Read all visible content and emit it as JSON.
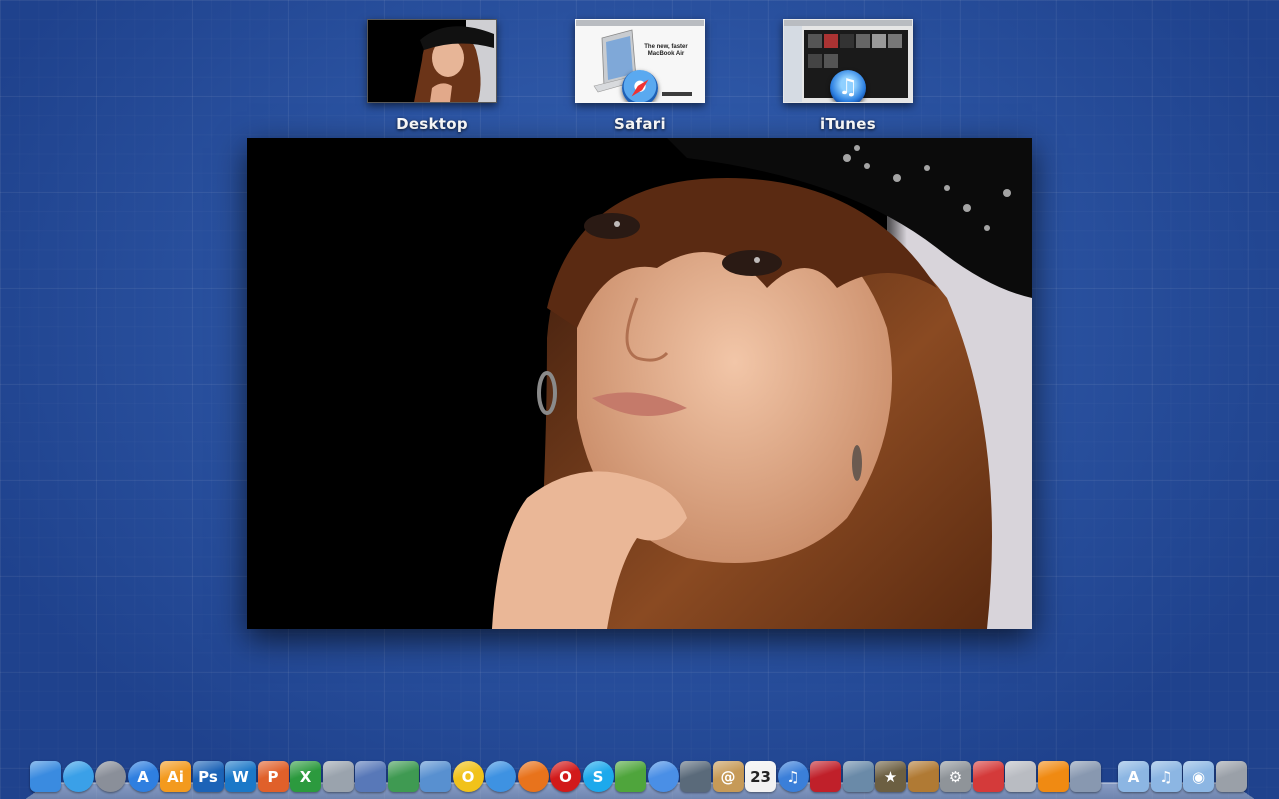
{
  "spaces": [
    {
      "id": "desktop",
      "label": "Desktop"
    },
    {
      "id": "safari",
      "label": "Safari",
      "thumb_headline": "The new, faster MacBook Air"
    },
    {
      "id": "itunes",
      "label": "iTunes"
    }
  ],
  "dock": {
    "apps": [
      {
        "name": "finder-icon",
        "glyph": "",
        "bg": "#3a8be0",
        "round": false
      },
      {
        "name": "network-globe-icon",
        "glyph": "",
        "bg": "#3aa0e8",
        "round": true
      },
      {
        "name": "launchpad-rocket-icon",
        "glyph": "",
        "bg": "#8a8f99",
        "round": true
      },
      {
        "name": "app-store-icon",
        "glyph": "A",
        "bg": "#2f7fe0",
        "round": true
      },
      {
        "name": "illustrator-icon",
        "glyph": "Ai",
        "bg": "#f39a1e",
        "round": false
      },
      {
        "name": "photoshop-icon",
        "glyph": "Ps",
        "bg": "#1c63b7",
        "round": false
      },
      {
        "name": "word-icon",
        "glyph": "W",
        "bg": "#1b78c8",
        "round": false
      },
      {
        "name": "powerpoint-icon",
        "glyph": "P",
        "bg": "#e0602a",
        "round": false
      },
      {
        "name": "excel-icon",
        "glyph": "X",
        "bg": "#2c9a3e",
        "round": false
      },
      {
        "name": "script-editor-icon",
        "glyph": "",
        "bg": "#9aa3ad",
        "round": false
      },
      {
        "name": "keynote-icon",
        "glyph": "",
        "bg": "#5878b8",
        "round": false
      },
      {
        "name": "numbers-icon",
        "glyph": "",
        "bg": "#3f9a52",
        "round": false
      },
      {
        "name": "preview-icon",
        "glyph": "",
        "bg": "#5890d0",
        "round": false
      },
      {
        "name": "open-office-icon",
        "glyph": "O",
        "bg": "#f1c21a",
        "round": true
      },
      {
        "name": "safari-icon",
        "glyph": "",
        "bg": "#3e92e2",
        "round": true
      },
      {
        "name": "firefox-icon",
        "glyph": "",
        "bg": "#e8731c",
        "round": true
      },
      {
        "name": "opera-icon",
        "glyph": "O",
        "bg": "#d21a1a",
        "round": true
      },
      {
        "name": "skype-icon",
        "glyph": "S",
        "bg": "#1da9ec",
        "round": true
      },
      {
        "name": "messenger-icon",
        "glyph": "",
        "bg": "#4fa53c",
        "round": false
      },
      {
        "name": "ichat-icon",
        "glyph": "",
        "bg": "#4a8fe6",
        "round": true
      },
      {
        "name": "facetime-icon",
        "glyph": "",
        "bg": "#5a6a7a",
        "round": false
      },
      {
        "name": "address-book-icon",
        "glyph": "@",
        "bg": "#c69a58",
        "round": false
      },
      {
        "name": "calendar-icon",
        "glyph": "23",
        "bg": "#f2f2f2",
        "round": false
      },
      {
        "name": "itunes-icon",
        "glyph": "♫",
        "bg": "#3b7fd9",
        "round": true
      },
      {
        "name": "photo-booth-icon",
        "glyph": "",
        "bg": "#c0202a",
        "round": false
      },
      {
        "name": "iphoto-icon",
        "glyph": "",
        "bg": "#6a8aa8",
        "round": false
      },
      {
        "name": "imovie-icon",
        "glyph": "★",
        "bg": "#6c5f42",
        "round": false
      },
      {
        "name": "garageband-icon",
        "glyph": "",
        "bg": "#b07a34",
        "round": false
      },
      {
        "name": "system-preferences-icon",
        "glyph": "⚙",
        "bg": "#8f9499",
        "round": false
      },
      {
        "name": "instastats-icon",
        "glyph": "",
        "bg": "#d43a3a",
        "round": false
      },
      {
        "name": "time-machine-icon",
        "glyph": "",
        "bg": "#b9bcc2",
        "round": false
      },
      {
        "name": "vlc-icon",
        "glyph": "",
        "bg": "#f08a12",
        "round": false
      },
      {
        "name": "preview-photos-icon",
        "glyph": "",
        "bg": "#8898b0",
        "round": false
      }
    ],
    "folders": [
      {
        "name": "applications-folder-icon",
        "glyph": "A",
        "bg": "#8cb6e3"
      },
      {
        "name": "music-folder-icon",
        "glyph": "♫",
        "bg": "#8cb6e3"
      },
      {
        "name": "downloads-folder-icon",
        "glyph": "◉",
        "bg": "#8cb6e3"
      },
      {
        "name": "trash-icon",
        "glyph": "",
        "bg": "#9aa0a8"
      }
    ]
  }
}
